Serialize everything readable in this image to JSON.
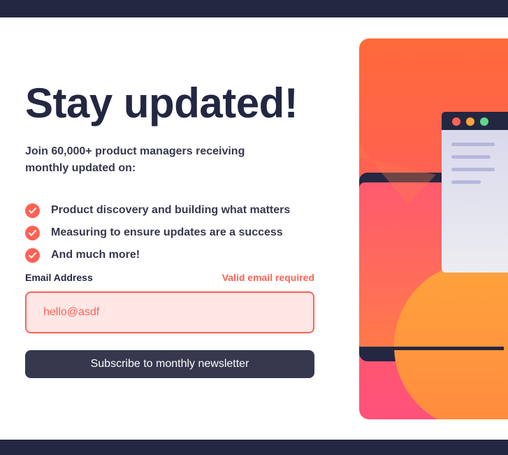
{
  "signup": {
    "title": "Stay updated!",
    "intro": "Join 60,000+ product managers receiving monthly updated on:",
    "features": [
      {
        "label": "Product discovery and building what matters",
        "icon": "check-icon"
      },
      {
        "label": "Measuring to ensure updates are a success",
        "icon": "check-icon"
      },
      {
        "label": "And much more!",
        "icon": "check-icon"
      }
    ],
    "form": {
      "email_label": "Email Address",
      "error_message": "Valid email required",
      "email_value": "hello@asdf",
      "submit_label": "Subscribe to monthly newsletter"
    }
  },
  "colors": {
    "background": "#242742",
    "card": "#ffffff",
    "heading": "#242742",
    "text": "#36384d",
    "accent": "#ff6155",
    "error_bg": "#ffe7e6",
    "button": "#36384d",
    "gradient_top": "#ff6a3a",
    "gradient_bottom": "#ff527b"
  }
}
